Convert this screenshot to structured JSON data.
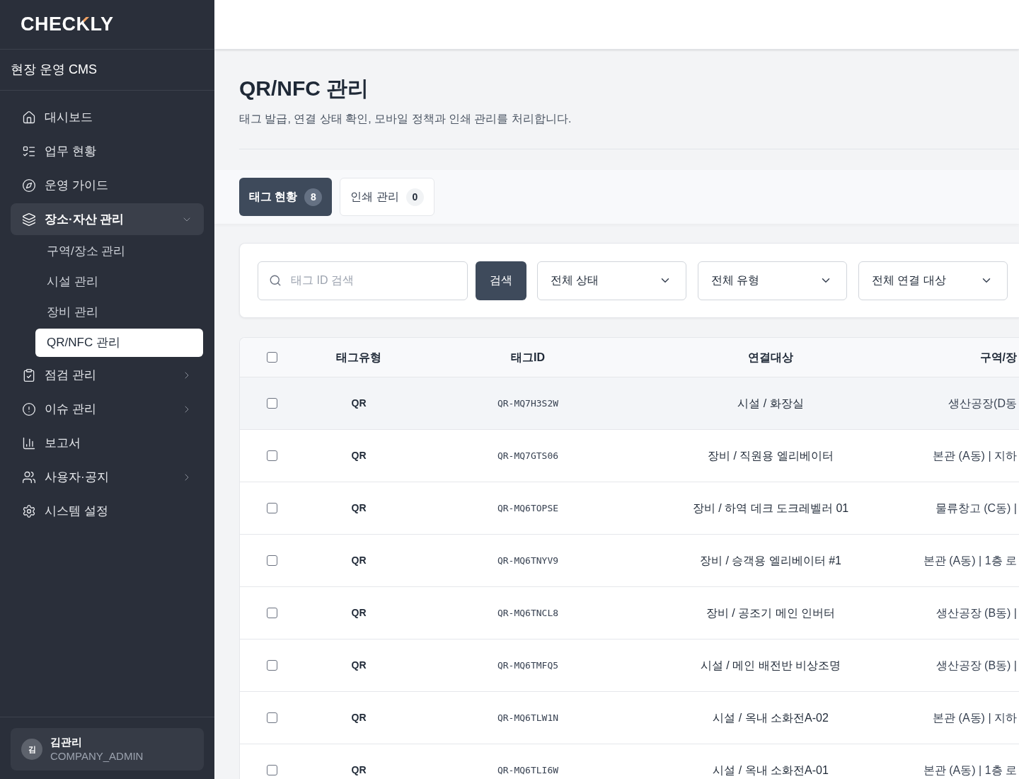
{
  "sidebar": {
    "logo": [
      {
        "text": "CHEC",
        "accent": false
      },
      {
        "text": "K",
        "accent": true
      },
      {
        "text": "LY",
        "accent": false
      }
    ],
    "workspace": "현장 운영 CMS",
    "nav": [
      {
        "kind": "link",
        "label": "대시보드",
        "selected": false
      },
      {
        "kind": "link",
        "label": "업무 현황",
        "selected": false
      },
      {
        "kind": "link",
        "label": "운영 가이드",
        "selected": false
      },
      {
        "kind": "group",
        "label": "장소·자산 관리",
        "selected": false,
        "expanded": true,
        "children": [
          {
            "label": "구역/장소 관리",
            "selected": false
          },
          {
            "label": "시설 관리",
            "selected": false
          },
          {
            "label": "장비 관리",
            "selected": false
          },
          {
            "label": "QR/NFC 관리",
            "selected": true
          }
        ]
      },
      {
        "kind": "group",
        "label": "점검 관리",
        "selected": false,
        "expanded": false
      },
      {
        "kind": "group",
        "label": "이슈 관리",
        "selected": false,
        "expanded": false
      },
      {
        "kind": "link",
        "label": "보고서",
        "selected": false
      },
      {
        "kind": "group",
        "label": "사용자·공지",
        "selected": false,
        "expanded": false
      },
      {
        "kind": "link",
        "label": "시스템 설정",
        "selected": false
      }
    ],
    "user": {
      "initial": "김",
      "name": "김관리",
      "role": "COMPANY_ADMIN"
    }
  },
  "page": {
    "title": "QR/NFC 관리",
    "description": "태그 발급, 연결 상태 확인, 모바일 정책과 인쇄 관리를 처리합니다."
  },
  "tabs": [
    {
      "label": "태그 현황",
      "count": "8",
      "selected": true
    },
    {
      "label": "인쇄 관리",
      "count": "0",
      "selected": false
    }
  ],
  "filters": {
    "search": {
      "placeholder": "태그 ID 검색"
    },
    "search_button": "검색",
    "dropdowns": [
      {
        "value": "전체 상태"
      },
      {
        "value": "전체 유형"
      },
      {
        "value": "전체 연결 대상"
      }
    ]
  },
  "table": {
    "select_all": {
      "checked": false
    },
    "columns": [
      "태그유형",
      "태그ID",
      "연결대상",
      "구역/장"
    ],
    "rows": [
      {
        "checked": false,
        "hovered": true,
        "cells": [
          "QR",
          "QR-MQ7H3S2W",
          "시설 / 화장실",
          "생산공장(D동"
        ]
      },
      {
        "checked": false,
        "hovered": false,
        "cells": [
          "QR",
          "QR-MQ7GTS06",
          "장비 / 직원용 엘리베이터",
          "본관 (A동) | 지하"
        ]
      },
      {
        "checked": false,
        "hovered": false,
        "cells": [
          "QR",
          "QR-MQ6TOPSE",
          "장비 / 하역 데크 도크레벨러 01",
          "물류창고 (C동) |"
        ]
      },
      {
        "checked": false,
        "hovered": false,
        "cells": [
          "QR",
          "QR-MQ6TNYV9",
          "장비 / 승객용 엘리베이터 #1",
          "본관 (A동) | 1층 로"
        ]
      },
      {
        "checked": false,
        "hovered": false,
        "cells": [
          "QR",
          "QR-MQ6TNCL8",
          "장비 / 공조기 메인 인버터",
          "생산공장 (B동) |"
        ]
      },
      {
        "checked": false,
        "hovered": false,
        "cells": [
          "QR",
          "QR-MQ6TMFQ5",
          "시설 / 메인 배전반 비상조명",
          "생산공장 (B동) |"
        ]
      },
      {
        "checked": false,
        "hovered": false,
        "cells": [
          "QR",
          "QR-MQ6TLW1N",
          "시설 / 옥내 소화전A-02",
          "본관 (A동) | 지하"
        ]
      },
      {
        "checked": false,
        "hovered": false,
        "cells": [
          "QR",
          "QR-MQ6TLI6W",
          "시설 / 옥내 소화전A-01",
          "본관 (A동) | 1층 로"
        ]
      }
    ]
  }
}
